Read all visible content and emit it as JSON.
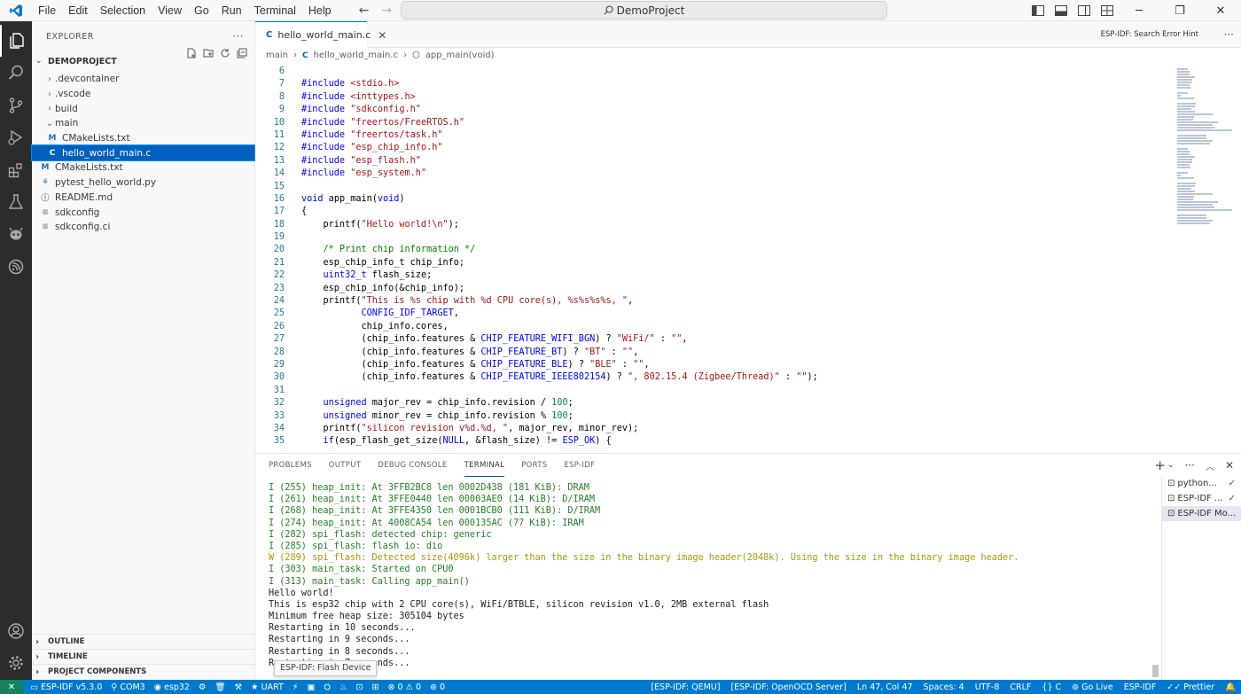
{
  "menu": [
    "File",
    "Edit",
    "Selection",
    "View",
    "Go",
    "Run",
    "Terminal",
    "Help"
  ],
  "command_center": {
    "label": "DemoProject"
  },
  "sidebar": {
    "title": "EXPLORER",
    "project": "DEMOPROJECT",
    "items": [
      {
        "label": ".devcontainer",
        "type": "folder",
        "expanded": false,
        "depth": 0
      },
      {
        "label": ".vscode",
        "type": "folder",
        "expanded": false,
        "depth": 0
      },
      {
        "label": "build",
        "type": "folder",
        "expanded": false,
        "depth": 0
      },
      {
        "label": "main",
        "type": "folder",
        "expanded": true,
        "depth": 0
      },
      {
        "label": "CMakeLists.txt",
        "type": "cmake",
        "depth": 1
      },
      {
        "label": "hello_world_main.c",
        "type": "c",
        "depth": 1,
        "selected": true
      },
      {
        "label": "CMakeLists.txt",
        "type": "cmake",
        "depth": 0
      },
      {
        "label": "pytest_hello_world.py",
        "type": "python",
        "depth": 0
      },
      {
        "label": "README.md",
        "type": "text",
        "depth": 0
      },
      {
        "label": "sdkconfig",
        "type": "text",
        "depth": 0
      },
      {
        "label": "sdkconfig.ci",
        "type": "text",
        "depth": 0
      }
    ],
    "bottom_sections": [
      "OUTLINE",
      "TIMELINE",
      "PROJECT COMPONENTS"
    ]
  },
  "editor": {
    "tab_label": "hello_world_main.c",
    "action_label": "ESP-IDF: Search Error Hint",
    "breadcrumb": [
      "main",
      "hello_world_main.c",
      "app_main(void)"
    ],
    "lines": [
      {
        "n": "6",
        "t": ""
      },
      {
        "n": "7",
        "t": "#include <stdio.h>"
      },
      {
        "n": "8",
        "t": "#include <inttypes.h>"
      },
      {
        "n": "9",
        "t": "#include \"sdkconfig.h\""
      },
      {
        "n": "10",
        "t": "#include \"freertos/FreeRTOS.h\""
      },
      {
        "n": "11",
        "t": "#include \"freertos/task.h\""
      },
      {
        "n": "12",
        "t": "#include \"esp_chip_info.h\""
      },
      {
        "n": "13",
        "t": "#include \"esp_flash.h\""
      },
      {
        "n": "14",
        "t": "#include \"esp_system.h\""
      },
      {
        "n": "15",
        "t": ""
      },
      {
        "n": "16",
        "t": "void app_main(void)"
      },
      {
        "n": "17",
        "t": "{"
      },
      {
        "n": "18",
        "t": "    printf(\"Hello world!\\n\");"
      },
      {
        "n": "19",
        "t": ""
      },
      {
        "n": "20",
        "t": "    /* Print chip information */"
      },
      {
        "n": "21",
        "t": "    esp_chip_info_t chip_info;"
      },
      {
        "n": "22",
        "t": "    uint32_t flash_size;"
      },
      {
        "n": "23",
        "t": "    esp_chip_info(&chip_info);"
      },
      {
        "n": "24",
        "t": "    printf(\"This is %s chip with %d CPU core(s), %s%s%s%s, \","
      },
      {
        "n": "25",
        "t": "           CONFIG_IDF_TARGET,"
      },
      {
        "n": "26",
        "t": "           chip_info.cores,"
      },
      {
        "n": "27",
        "t": "           (chip_info.features & CHIP_FEATURE_WIFI_BGN) ? \"WiFi/\" : \"\","
      },
      {
        "n": "28",
        "t": "           (chip_info.features & CHIP_FEATURE_BT) ? \"BT\" : \"\","
      },
      {
        "n": "29",
        "t": "           (chip_info.features & CHIP_FEATURE_BLE) ? \"BLE\" : \"\","
      },
      {
        "n": "30",
        "t": "           (chip_info.features & CHIP_FEATURE_IEEE802154) ? \", 802.15.4 (Zigbee/Thread)\" : \"\");"
      },
      {
        "n": "31",
        "t": ""
      },
      {
        "n": "32",
        "t": "    unsigned major_rev = chip_info.revision / 100;"
      },
      {
        "n": "33",
        "t": "    unsigned minor_rev = chip_info.revision % 100;"
      },
      {
        "n": "34",
        "t": "    printf(\"silicon revision v%d.%d, \", major_rev, minor_rev);"
      },
      {
        "n": "35",
        "t": "    if(esp_flash_get_size(NULL, &flash_size) != ESP_OK) {"
      }
    ]
  },
  "panel": {
    "tabs": [
      "PROBLEMS",
      "OUTPUT",
      "DEBUG CONSOLE",
      "TERMINAL",
      "PORTS",
      "ESP-IDF"
    ],
    "active_tab": "TERMINAL",
    "terminal_lines": [
      {
        "t": "I (255) heap_init: At 3FFB2BC8 len 0002D438 (181 KiB): DRAM",
        "k": "info"
      },
      {
        "t": "I (261) heap_init: At 3FFE0440 len 00003AE0 (14 KiB): D/IRAM",
        "k": "info"
      },
      {
        "t": "I (268) heap_init: At 3FFE4350 len 0001BCB0 (111 KiB): D/IRAM",
        "k": "info"
      },
      {
        "t": "I (274) heap_init: At 4008CA54 len 000135AC (77 KiB): IRAM",
        "k": "info"
      },
      {
        "t": "I (282) spi_flash: detected chip: generic",
        "k": "info"
      },
      {
        "t": "I (285) spi_flash: flash io: dio",
        "k": "info"
      },
      {
        "t": "W (289) spi_flash: Detected size(4096k) larger than the size in the binary image header(2048k). Using the size in the binary image header.",
        "k": "warn"
      },
      {
        "t": "I (303) main_task: Started on CPU0",
        "k": "info"
      },
      {
        "t": "I (313) main_task: Calling app_main()",
        "k": "info"
      },
      {
        "t": "Hello world!",
        "k": "plain"
      },
      {
        "t": "This is esp32 chip with 2 CPU core(s), WiFi/BTBLE, silicon revision v1.0, 2MB external flash",
        "k": "plain"
      },
      {
        "t": "Minimum free heap size: 305104 bytes",
        "k": "plain"
      },
      {
        "t": "Restarting in 10 seconds...",
        "k": "plain"
      },
      {
        "t": "Restarting in 9 seconds...",
        "k": "plain"
      },
      {
        "t": "Restarting in 8 seconds...",
        "k": "plain"
      },
      {
        "t": "Restarting in 7 seconds...",
        "k": "plain"
      }
    ],
    "terminals": [
      {
        "label": "python...",
        "check": true
      },
      {
        "label": "ESP-IDF ...",
        "check": true
      },
      {
        "label": "ESP-IDF Mo...",
        "check": false,
        "selected": true
      }
    ]
  },
  "tooltip": {
    "text": "ESP-IDF: Flash Device"
  },
  "statusbar": {
    "left": [
      "ESP-IDF v5.3.0",
      "COM3",
      "esp32",
      "UART",
      "ESP-IDF: QEMU",
      "0",
      "0",
      "0"
    ],
    "right": [
      "[ESP-IDF: QEMU]",
      "[ESP-IDF: OpenOCD Server]",
      "Ln 47, Col 47",
      "Spaces: 4",
      "UTF-8",
      "CRLF",
      "{} C",
      "Go Live",
      "ESP-IDF",
      "Prettier"
    ]
  },
  "colors": {
    "accent": "#007acc",
    "selection": "#0060c0",
    "activity_bar": "#2c2c2c",
    "remote": "#16825d"
  }
}
